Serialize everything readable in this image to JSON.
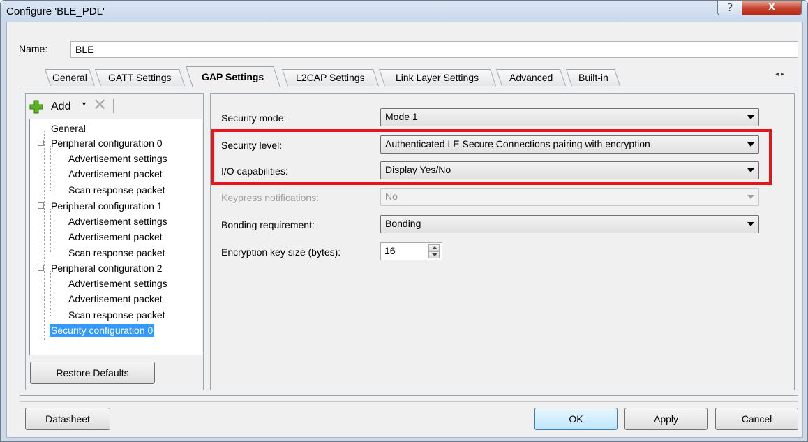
{
  "window": {
    "title": "Configure 'BLE_PDL'",
    "help_glyph": "?",
    "close_glyph": "X"
  },
  "name": {
    "label": "Name:",
    "value": "BLE"
  },
  "tabs": [
    {
      "label": "General"
    },
    {
      "label": "GATT Settings"
    },
    {
      "label": "GAP Settings",
      "active": true
    },
    {
      "label": "L2CAP Settings"
    },
    {
      "label": "Link Layer Settings"
    },
    {
      "label": "Advanced"
    },
    {
      "label": "Built-in"
    }
  ],
  "tab_scroll": {
    "left": "◂",
    "right": "▸"
  },
  "toolbar": {
    "add_label": "Add",
    "add_caret": "▾",
    "delete_glyph": "✕"
  },
  "tree": {
    "items": [
      {
        "label": "General"
      },
      {
        "label": "Peripheral configuration 0",
        "expander": "−"
      },
      {
        "label": "Advertisement settings"
      },
      {
        "label": "Advertisement packet"
      },
      {
        "label": "Scan response packet"
      },
      {
        "label": "Peripheral configuration 1",
        "expander": "−"
      },
      {
        "label": "Advertisement settings"
      },
      {
        "label": "Advertisement packet"
      },
      {
        "label": "Scan response packet"
      },
      {
        "label": "Peripheral configuration 2",
        "expander": "−"
      },
      {
        "label": "Advertisement settings"
      },
      {
        "label": "Advertisement packet"
      },
      {
        "label": "Scan response packet"
      },
      {
        "label": "Security configuration 0",
        "selected": true
      }
    ]
  },
  "restore_defaults": "Restore Defaults",
  "properties": {
    "security_mode": {
      "label": "Security mode:",
      "value": "Mode 1"
    },
    "security_level": {
      "label": "Security level:",
      "value": "Authenticated LE Secure Connections pairing with encryption"
    },
    "io_capabilities": {
      "label": "I/O capabilities:",
      "value": "Display Yes/No"
    },
    "keypress_notifications": {
      "label": "Keypress notifications:",
      "value": "No",
      "disabled": true
    },
    "bonding_requirement": {
      "label": "Bonding requirement:",
      "value": "Bonding"
    },
    "encryption_key_size": {
      "label": "Encryption key size (bytes):",
      "value": "16"
    }
  },
  "highlight_color": "#e8141c",
  "footer": {
    "datasheet": "Datasheet",
    "ok": "OK",
    "apply": "Apply",
    "cancel": "Cancel"
  }
}
